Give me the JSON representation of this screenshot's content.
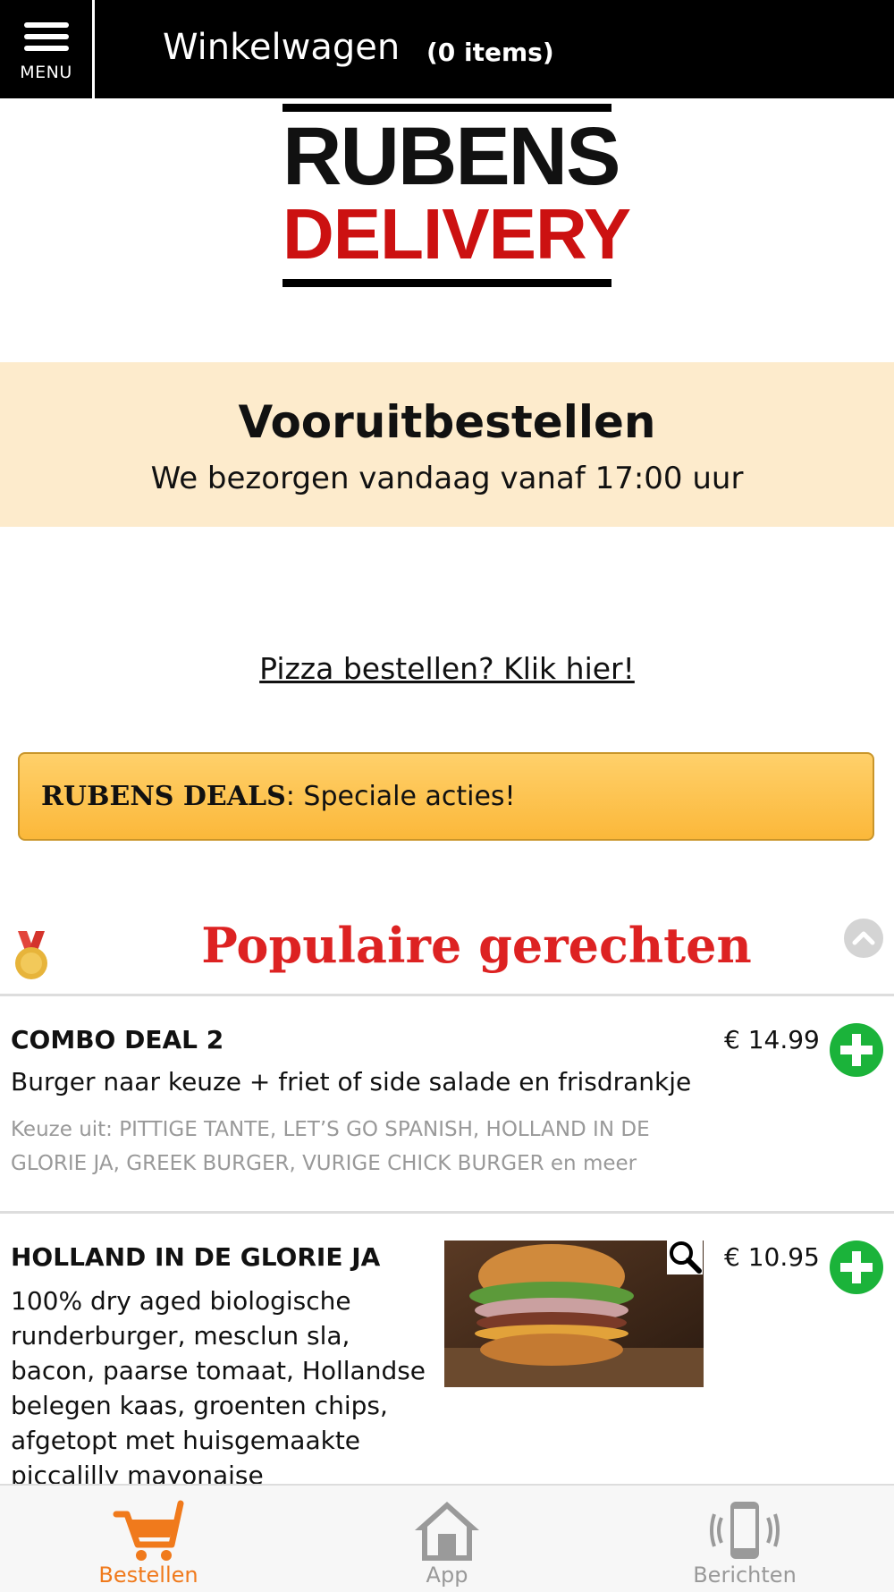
{
  "header": {
    "menu_label": "MENU",
    "cart_title": "Winkelwagen",
    "cart_count": "(0 items)"
  },
  "logo": {
    "line1": "RUBENS",
    "line2": "DELIVERY"
  },
  "preorder": {
    "title": "Vooruitbestellen",
    "subtitle": "We bezorgen vandaag vanaf 17:00 uur"
  },
  "pizza_link": "Pizza bestellen? Klik hier!",
  "deals": {
    "bold": "RUBENS DEALS",
    "rest": ": Speciale acties!"
  },
  "section": {
    "title": "Populaire gerechten",
    "icon": "medal-icon"
  },
  "items": [
    {
      "name": "COMBO DEAL 2",
      "price": "€ 14.99",
      "description": "Burger naar keuze + friet of side salade en frisdrankje",
      "note": "Keuze uit: PITTIGE TANTE, LET’S GO SPANISH, HOLLAND IN DE GLORIE JA, GREEK BURGER, VURIGE CHICK BURGER en meer"
    },
    {
      "name": "HOLLAND IN DE GLORIE JA",
      "price": "€ 10.95",
      "desc_lines": [
        "100% dry aged biologische",
        "runderburger, mesclun sla,",
        "bacon, paarse tomaat, Hollandse",
        "belegen kaas, groenten chips,",
        "afgetopt met huisgemaakte",
        "piccalilly mayonaise"
      ]
    }
  ],
  "bottom_nav": {
    "items": [
      {
        "label": "Bestellen",
        "icon": "cart-icon"
      },
      {
        "label": "App",
        "icon": "home-icon"
      },
      {
        "label": "Berichten",
        "icon": "phone-icon"
      }
    ],
    "active_color": "#f07a1c"
  },
  "colors": {
    "accent_red": "#dd2222",
    "add_green": "#1bb33a",
    "preorder_bg": "#fdebcc"
  }
}
